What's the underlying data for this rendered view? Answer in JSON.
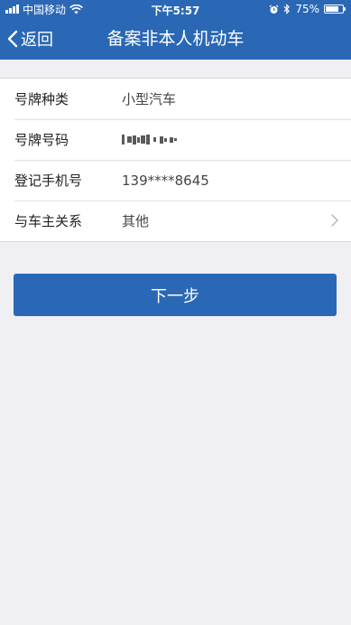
{
  "status_bar": {
    "carrier": "中国移动",
    "time": "下午5:57",
    "battery_percent": "75%",
    "battery_level": 0.75
  },
  "nav": {
    "back_label": "返回",
    "title": "备案非本人机动车"
  },
  "form": {
    "rows": [
      {
        "label": "号牌种类",
        "value": "小型汽车"
      },
      {
        "label": "号牌号码",
        "value_icon": "masked-plate-number"
      },
      {
        "label": "登记手机号",
        "value": "139****8645"
      },
      {
        "label": "与车主关系",
        "value": "其他",
        "trailing_icon": "chevron-right-icon"
      }
    ]
  },
  "next_button": {
    "label": "下一步"
  },
  "colors": {
    "primary": "#2a68b6",
    "background": "#efeff4"
  }
}
